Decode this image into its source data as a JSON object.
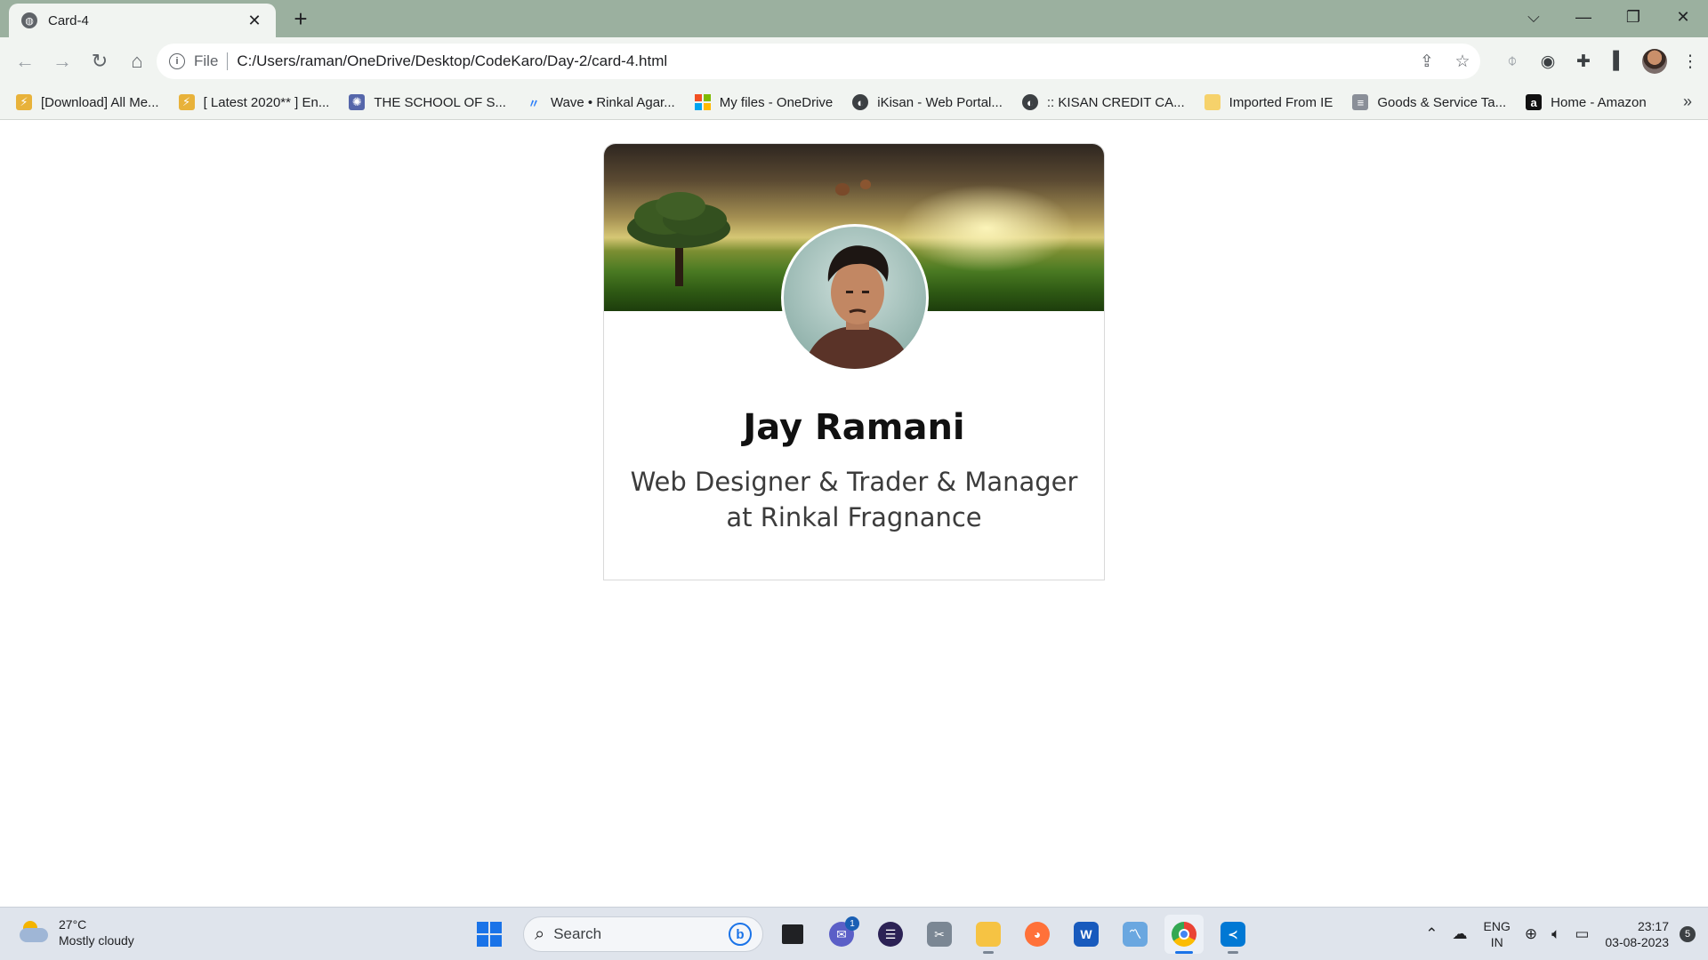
{
  "browser": {
    "tab": {
      "title": "Card-4",
      "close": "✕"
    },
    "new_tab": "+",
    "window_controls": {
      "dropdown": "⌵",
      "minimize": "—",
      "restore": "❐",
      "close": "✕"
    },
    "address": {
      "scheme": "File",
      "url": "C:/Users/raman/OneDrive/Desktop/CodeKaro/Day-2/card-4.html"
    },
    "bookmarks": [
      {
        "label": "[Download] All Me...",
        "icon": "download-bookmark-icon",
        "color": "#e8b23a"
      },
      {
        "label": "[ Latest 2020** ] En...",
        "icon": "download-bookmark-icon",
        "color": "#e8b23a"
      },
      {
        "label": "THE SCHOOL OF S...",
        "icon": "gear-bookmark-icon",
        "color": "#5566aa"
      },
      {
        "label": "Wave • Rinkal Agar...",
        "icon": "wave-bookmark-icon",
        "color": "#2d7ff9"
      },
      {
        "label": "My files - OneDrive",
        "icon": "microsoft-icon",
        "color": "#f25022"
      },
      {
        "label": "iKisan - Web Portal...",
        "icon": "globe-icon",
        "color": "#3c4043"
      },
      {
        "label": ":: KISAN CREDIT CA...",
        "icon": "globe-icon",
        "color": "#3c4043"
      },
      {
        "label": "Imported From IE",
        "icon": "folder-icon",
        "color": "#f6d26b"
      },
      {
        "label": "Goods & Service Ta...",
        "icon": "gst-icon",
        "color": "#8a8f98"
      },
      {
        "label": "Home - Amazon",
        "icon": "amazon-icon",
        "color": "#111111"
      }
    ],
    "bookmarks_more": "»"
  },
  "card": {
    "name": "Jay Ramani",
    "role": "Web Designer & Trader & Manager at Rinkal Fragnance"
  },
  "taskbar": {
    "weather": {
      "temp": "27°C",
      "condition": "Mostly cloudy"
    },
    "search_label": "Search",
    "teams_badge": "1",
    "tray": {
      "lang_top": "ENG",
      "lang_bottom": "IN",
      "time": "23:17",
      "date": "03-08-2023",
      "notifications": "5"
    }
  }
}
